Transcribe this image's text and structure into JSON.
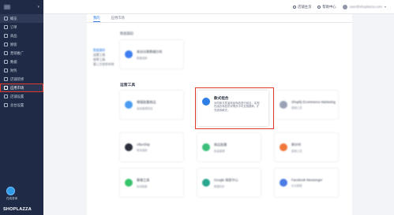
{
  "sidebar": {
    "items": [
      {
        "label": "概览",
        "icon": "home-icon"
      },
      {
        "label": "订单",
        "icon": "orders-icon"
      },
      {
        "label": "商品",
        "icon": "products-icon"
      },
      {
        "label": "顾客",
        "icon": "customers-icon"
      },
      {
        "label": "营销推广",
        "icon": "marketing-icon"
      },
      {
        "label": "数据",
        "icon": "analytics-icon"
      },
      {
        "label": "财务",
        "icon": "finance-icon"
      },
      {
        "label": "店铺装修",
        "icon": "store-design-icon"
      },
      {
        "label": "应用市场",
        "icon": "app-market-icon"
      },
      {
        "label": "店铺设置",
        "icon": "store-settings-icon"
      },
      {
        "label": "总台设置",
        "icon": "console-settings-icon"
      }
    ],
    "avatar_label": "在线咨询",
    "brand": "SHOPLAZZA"
  },
  "topbar": {
    "store_home": "店铺主页",
    "help_center": "帮助中心",
    "email": "user@shoplazza.com"
  },
  "tabs": [
    {
      "label": "我的"
    },
    {
      "label": "应用市场"
    }
  ],
  "side_nav": [
    "数据跟踪",
    "运营工具",
    "效率工具",
    "第三方合作伙伴"
  ],
  "sections": {
    "top": "数据跟踪",
    "ops": "运营工具"
  },
  "cards": {
    "top": {
      "title": "来自谷歌数据分析",
      "desc": "数据追踪"
    },
    "row1": [
      {
        "title": "增值批量商品",
        "desc": "高效管理商品"
      },
      {
        "title": "款式组合",
        "desc": "对同款式发量商品商品进行组合，实现在组合商品的详情页中可互相跳转，扩充选择款式。"
      },
      {
        "title": "Shopify Ecommerce Marketing",
        "desc": "营销工具"
      }
    ],
    "row2": [
      {
        "title": "AfterShip",
        "desc": "物流追踪"
      },
      {
        "title": "商品批量",
        "desc": "批量管理"
      },
      {
        "title": "倒计时",
        "desc": "营销工具"
      }
    ],
    "row3": [
      {
        "title": "客服工具",
        "desc": "在线客服"
      },
      {
        "title": "Google 商家中心",
        "desc": "数据同步"
      },
      {
        "title": "Facebook Messenger",
        "desc": "社交客服"
      }
    ]
  },
  "colors": {
    "sidebar_bg": "#1f2b46",
    "accent": "#2f7ee6",
    "highlight": "#e03a2f"
  }
}
